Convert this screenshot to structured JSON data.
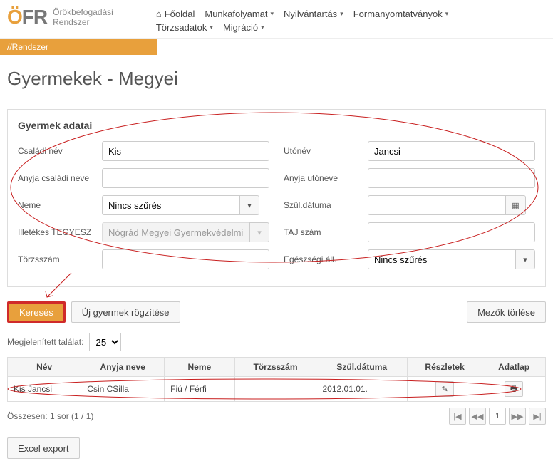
{
  "brand": {
    "o": "Ö",
    "f": "F",
    "r": "R",
    "line1": "Örökbefogadási",
    "line2": "Rendszer"
  },
  "nav": {
    "home": "Főoldal",
    "workflow": "Munkafolyamat",
    "registry": "Nyilvántartás",
    "forms": "Formanyomtatványok",
    "master": "Törzsadatok",
    "migration": "Migráció"
  },
  "breadcrumb": "//Rendszer",
  "pageTitle": "Gyermekek - Megyei",
  "panelTitle": "Gyermek adatai",
  "labels": {
    "familyName": "Családi név",
    "givenName": "Utónév",
    "motherFamily": "Anyja családi neve",
    "motherGiven": "Anyja utóneve",
    "gender": "Neme",
    "dob": "Szül.dátuma",
    "tegyesz": "Illetékes TEGYESZ",
    "taj": "TAJ szám",
    "regno": "Törzsszám",
    "health": "Egészségi áll."
  },
  "values": {
    "familyName": "Kis",
    "givenName": "Jancsi",
    "gender": "Nincs szűrés",
    "tegyesz": "Nógrád Megyei Gyermekvédelmi Központ",
    "health": "Nincs szűrés"
  },
  "buttons": {
    "search": "Keresés",
    "new": "Új gyermek rögzítése",
    "clear": "Mezők törlése",
    "export": "Excel export"
  },
  "tableControls": {
    "label": "Megjelenített találat:",
    "pageSize": "25"
  },
  "columns": {
    "name": "Név",
    "mother": "Anyja neve",
    "gender": "Neme",
    "regno": "Törzsszám",
    "dob": "Szül.dátuma",
    "details": "Részletek",
    "sheet": "Adatlap"
  },
  "rows": [
    {
      "name": "Kis Jancsi",
      "mother": "Csin CSilla",
      "gender": "Fiú / Férfi",
      "regno": "",
      "dob": "2012.01.01."
    }
  ],
  "summary": "Összesen: 1 sor (1 / 1)",
  "pager": {
    "first": "|◀",
    "prev": "◀◀",
    "page": "1",
    "next": "▶▶",
    "last": "▶|"
  },
  "icons": {
    "home": "⌂",
    "caret": "▾",
    "calendar": "▦",
    "edit": "✎",
    "print": "🖶"
  }
}
